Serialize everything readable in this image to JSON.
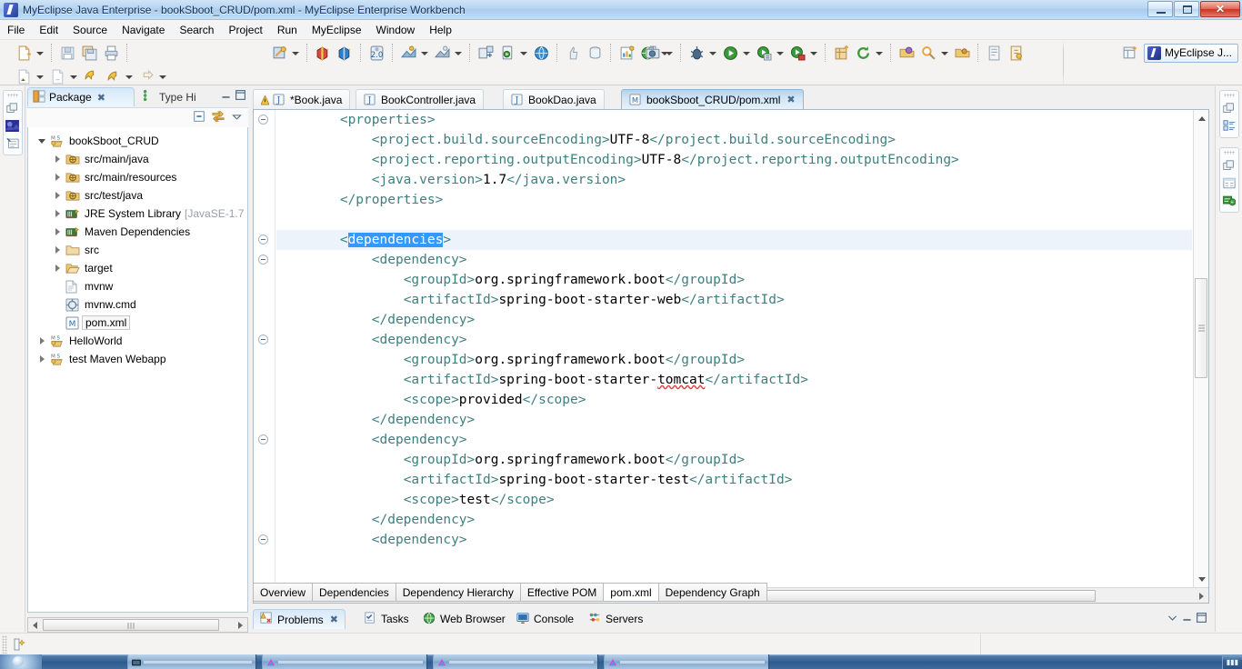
{
  "window": {
    "title": "MyEclipse Java Enterprise - bookSboot_CRUD/pom.xml - MyEclipse Enterprise Workbench",
    "minimize_label": "Minimize",
    "maximize_label": "Maximize",
    "close_label": "✕"
  },
  "menu": {
    "items": [
      {
        "label": "File"
      },
      {
        "label": "Edit"
      },
      {
        "label": "Source"
      },
      {
        "label": "Navigate"
      },
      {
        "label": "Search"
      },
      {
        "label": "Project"
      },
      {
        "label": "Run"
      },
      {
        "label": "MyEclipse"
      },
      {
        "label": "Window"
      },
      {
        "label": "Help"
      }
    ]
  },
  "toolbar": {
    "perspective_active": "MyEclipse J...",
    "open_perspective_label": "Open Perspective",
    "row1_icons": [
      "new-file-icon",
      "save-icon",
      "save-all-icon",
      "print-icon",
      "build-all-icon",
      "new-package-icon",
      "new-class-icon",
      "validate-icon",
      "new-jsp-icon",
      "new-xml-icon",
      "deploy-icon",
      "server-icon",
      "browser-icon",
      "thumbs-up-icon",
      "refresh-database-icon",
      "report-icon",
      "web-globe-icon"
    ],
    "row2_icons": [
      "new-annotation-icon",
      "new-interface-icon",
      "back-icon",
      "forward-icon",
      "next-icon"
    ],
    "right_icons": [
      "camera-icon",
      "debug-icon",
      "run-icon",
      "run-config-icon",
      "coverage-icon",
      "new-project-icon",
      "refresh-icon",
      "open-type-icon",
      "search-icon",
      "open-resource-icon",
      "toggle-breadcrumb-icon",
      "pin-icon"
    ]
  },
  "left_dock": {
    "icons": [
      "restore-icon",
      "welcome-icon",
      "outline-mini-icon"
    ]
  },
  "right_dock": {
    "group_a": [
      "restore-icon",
      "outline-icon"
    ],
    "group_b": [
      "restore-icon",
      "properties-icon",
      "snippets-icon"
    ]
  },
  "package_explorer": {
    "tabs": [
      {
        "label": "Package",
        "icon": "package-explorer-icon",
        "active": true,
        "closable": true
      },
      {
        "label": "Type Hi",
        "icon": "type-hierarchy-icon",
        "active": false,
        "closable": false
      }
    ],
    "view_minimize": "Minimize",
    "view_maximize": "Maximize",
    "toolbar_icons": [
      "collapse-all-icon",
      "link-with-editor-icon",
      "view-menu-icon"
    ],
    "tree": [
      {
        "label": "bookSboot_CRUD",
        "indent": 0,
        "twist": "open",
        "icon": "maven-project-icon",
        "sub": ""
      },
      {
        "label": "src/main/java",
        "indent": 1,
        "twist": "closed",
        "icon": "source-folder-icon",
        "sub": ""
      },
      {
        "label": "src/main/resources",
        "indent": 1,
        "twist": "closed",
        "icon": "source-folder-icon",
        "sub": ""
      },
      {
        "label": "src/test/java",
        "indent": 1,
        "twist": "closed",
        "icon": "source-folder-icon",
        "sub": ""
      },
      {
        "label": "JRE System Library",
        "indent": 1,
        "twist": "closed",
        "icon": "library-icon",
        "sub": "[JavaSE-1.7"
      },
      {
        "label": "Maven Dependencies",
        "indent": 1,
        "twist": "closed",
        "icon": "library-icon",
        "sub": ""
      },
      {
        "label": "src",
        "indent": 1,
        "twist": "closed",
        "icon": "folder-icon",
        "sub": ""
      },
      {
        "label": "target",
        "indent": 1,
        "twist": "closed",
        "icon": "folder-open-icon",
        "sub": ""
      },
      {
        "label": "mvnw",
        "indent": 1,
        "twist": "none",
        "icon": "file-icon",
        "sub": ""
      },
      {
        "label": "mvnw.cmd",
        "indent": 1,
        "twist": "none",
        "icon": "cmd-file-icon",
        "sub": ""
      },
      {
        "label": "pom.xml",
        "indent": 1,
        "twist": "none",
        "icon": "maven-pom-icon",
        "sub": "",
        "selected": true
      },
      {
        "label": "HelloWorld",
        "indent": 0,
        "twist": "closed",
        "icon": "maven-project-icon",
        "sub": ""
      },
      {
        "label": "test Maven Webapp",
        "indent": 0,
        "twist": "closed",
        "icon": "maven-project-icon",
        "sub": ""
      }
    ]
  },
  "editor": {
    "tabs": [
      {
        "label": "*Book.java",
        "icon": "java-file-icon",
        "active": false,
        "dirty": true,
        "warning": true
      },
      {
        "label": "BookController.java",
        "icon": "java-file-icon",
        "active": false,
        "dirty": false,
        "warning": false
      },
      {
        "label": "BookDao.java",
        "icon": "java-file-icon",
        "active": false,
        "dirty": false,
        "warning": false
      },
      {
        "label": "bookSboot_CRUD/pom.xml",
        "icon": "maven-pom-icon",
        "active": true,
        "dirty": false,
        "warning": false,
        "closable": true
      }
    ],
    "selection": "dependencies",
    "lines": [
      {
        "indent": 2,
        "fold": true,
        "highlight": false,
        "parts": [
          {
            "t": "tag",
            "s": "<properties>"
          }
        ]
      },
      {
        "indent": 3,
        "fold": false,
        "highlight": false,
        "parts": [
          {
            "t": "tag",
            "s": "<project.build.sourceEncoding>"
          },
          {
            "t": "val",
            "s": "UTF-8"
          },
          {
            "t": "tag",
            "s": "</project.build.sourceEncoding>"
          }
        ]
      },
      {
        "indent": 3,
        "fold": false,
        "highlight": false,
        "parts": [
          {
            "t": "tag",
            "s": "<project.reporting.outputEncoding>"
          },
          {
            "t": "val",
            "s": "UTF-8"
          },
          {
            "t": "tag",
            "s": "</project.reporting.outputEncoding>"
          }
        ]
      },
      {
        "indent": 3,
        "fold": false,
        "highlight": false,
        "parts": [
          {
            "t": "tag",
            "s": "<java.version>"
          },
          {
            "t": "val",
            "s": "1.7"
          },
          {
            "t": "tag",
            "s": "</java.version>"
          }
        ]
      },
      {
        "indent": 2,
        "fold": false,
        "highlight": false,
        "parts": [
          {
            "t": "tag",
            "s": "</properties>"
          }
        ]
      },
      {
        "indent": 0,
        "fold": false,
        "highlight": false,
        "parts": []
      },
      {
        "indent": 2,
        "fold": true,
        "highlight": true,
        "parts": [
          {
            "t": "tag",
            "s": "<"
          },
          {
            "t": "sel",
            "s": "dependencies"
          },
          {
            "t": "tag",
            "s": ">"
          }
        ]
      },
      {
        "indent": 3,
        "fold": true,
        "highlight": false,
        "parts": [
          {
            "t": "tag",
            "s": "<dependency>"
          }
        ]
      },
      {
        "indent": 4,
        "fold": false,
        "highlight": false,
        "parts": [
          {
            "t": "tag",
            "s": "<groupId>"
          },
          {
            "t": "val",
            "s": "org.springframework.boot"
          },
          {
            "t": "tag",
            "s": "</groupId>"
          }
        ]
      },
      {
        "indent": 4,
        "fold": false,
        "highlight": false,
        "parts": [
          {
            "t": "tag",
            "s": "<artifactId>"
          },
          {
            "t": "val",
            "s": "spring-boot-starter-web"
          },
          {
            "t": "tag",
            "s": "</artifactId>"
          }
        ]
      },
      {
        "indent": 3,
        "fold": false,
        "highlight": false,
        "parts": [
          {
            "t": "tag",
            "s": "</dependency>"
          }
        ]
      },
      {
        "indent": 3,
        "fold": true,
        "highlight": false,
        "parts": [
          {
            "t": "tag",
            "s": "<dependency>"
          }
        ]
      },
      {
        "indent": 4,
        "fold": false,
        "highlight": false,
        "parts": [
          {
            "t": "tag",
            "s": "<groupId>"
          },
          {
            "t": "val",
            "s": "org.springframework.boot"
          },
          {
            "t": "tag",
            "s": "</groupId>"
          }
        ]
      },
      {
        "indent": 4,
        "fold": false,
        "highlight": false,
        "parts": [
          {
            "t": "tag",
            "s": "<artifactId>"
          },
          {
            "t": "val",
            "s": "spring-boot-starter-"
          },
          {
            "t": "squig",
            "s": "tomcat"
          },
          {
            "t": "tag",
            "s": "</artifactId>"
          }
        ]
      },
      {
        "indent": 4,
        "fold": false,
        "highlight": false,
        "parts": [
          {
            "t": "tag",
            "s": "<scope>"
          },
          {
            "t": "val",
            "s": "provided"
          },
          {
            "t": "tag",
            "s": "</scope>"
          }
        ]
      },
      {
        "indent": 3,
        "fold": false,
        "highlight": false,
        "parts": [
          {
            "t": "tag",
            "s": "</dependency>"
          }
        ]
      },
      {
        "indent": 3,
        "fold": true,
        "highlight": false,
        "parts": [
          {
            "t": "tag",
            "s": "<dependency>"
          }
        ]
      },
      {
        "indent": 4,
        "fold": false,
        "highlight": false,
        "parts": [
          {
            "t": "tag",
            "s": "<groupId>"
          },
          {
            "t": "val",
            "s": "org.springframework.boot"
          },
          {
            "t": "tag",
            "s": "</groupId>"
          }
        ]
      },
      {
        "indent": 4,
        "fold": false,
        "highlight": false,
        "parts": [
          {
            "t": "tag",
            "s": "<artifactId>"
          },
          {
            "t": "val",
            "s": "spring-boot-starter-test"
          },
          {
            "t": "tag",
            "s": "</artifactId>"
          }
        ]
      },
      {
        "indent": 4,
        "fold": false,
        "highlight": false,
        "parts": [
          {
            "t": "tag",
            "s": "<scope>"
          },
          {
            "t": "val",
            "s": "test"
          },
          {
            "t": "tag",
            "s": "</scope>"
          }
        ]
      },
      {
        "indent": 3,
        "fold": false,
        "highlight": false,
        "parts": [
          {
            "t": "tag",
            "s": "</dependency>"
          }
        ]
      },
      {
        "indent": 3,
        "fold": true,
        "highlight": false,
        "parts": [
          {
            "t": "tag",
            "s": "<dependency>"
          }
        ]
      }
    ]
  },
  "form_tabs": [
    {
      "label": "Overview",
      "active": false
    },
    {
      "label": "Dependencies",
      "active": false
    },
    {
      "label": "Dependency Hierarchy",
      "active": false
    },
    {
      "label": "Effective POM",
      "active": false
    },
    {
      "label": "pom.xml",
      "active": true
    },
    {
      "label": "Dependency Graph",
      "active": false
    }
  ],
  "bottom_panel": {
    "tabs": [
      {
        "label": "Problems",
        "icon": "problems-icon",
        "active": true,
        "closable": true
      },
      {
        "label": "Tasks",
        "icon": "tasks-icon",
        "active": false,
        "closable": false
      },
      {
        "label": "Web Browser",
        "icon": "web-browser-icon",
        "active": false,
        "closable": false
      },
      {
        "label": "Console",
        "icon": "console-icon",
        "active": false,
        "closable": false
      },
      {
        "label": "Servers",
        "icon": "servers-icon",
        "active": false,
        "closable": false
      }
    ],
    "minimize_label": "Minimize",
    "maximize_label": "Maximize",
    "restore_label": "Restore"
  },
  "status_bar": {
    "icon": "smart-insert-icon"
  },
  "taskbar": {
    "start_label": "Start",
    "items": [
      {
        "label": "",
        "icon": "explorer-icon"
      },
      {
        "label": "",
        "icon": "app-icon"
      },
      {
        "label": "",
        "icon": "app-icon"
      },
      {
        "label": "",
        "icon": "app-icon"
      }
    ],
    "tray_text": "▮▮▮"
  },
  "colors": {
    "title_accent": "#a9cbeb",
    "tag_color": "#3f7f7f",
    "selection_blue": "#3399ff",
    "highlight_row": "#ecf3fb",
    "taskbar_blue": "#2f5b8e"
  }
}
